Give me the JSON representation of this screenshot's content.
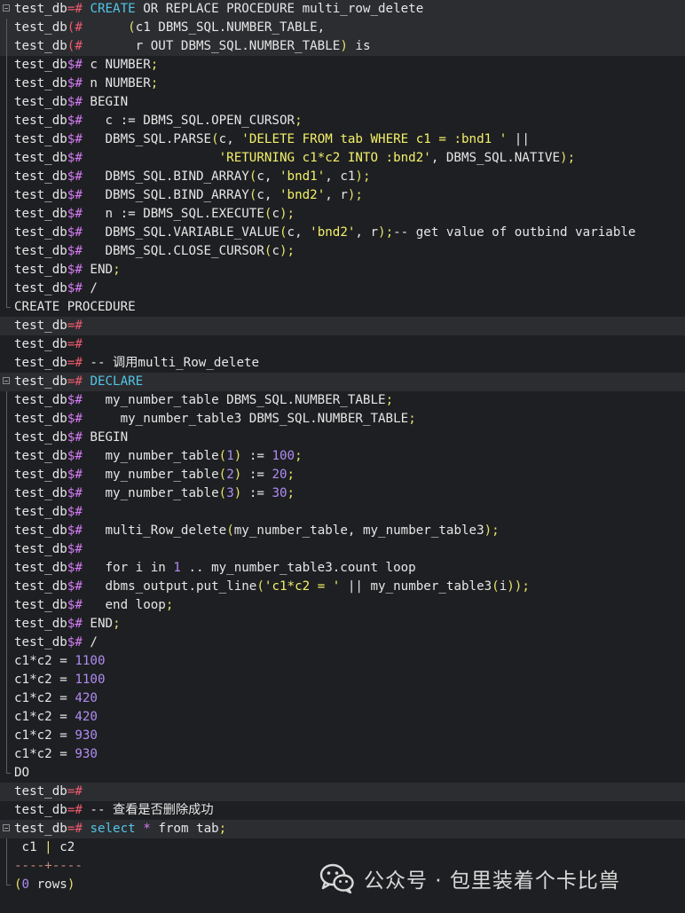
{
  "terminal": {
    "lines": [
      {
        "fold": "start",
        "hl": true,
        "segs": [
          {
            "t": "test_db",
            "c": "pr"
          },
          {
            "t": "=#",
            "c": "pc"
          },
          {
            "t": " "
          },
          {
            "t": "CREATE",
            "c": "kw"
          },
          {
            "t": " OR REPLACE PROCEDURE multi_row_delete"
          }
        ]
      },
      {
        "fold": "mid",
        "hl": true,
        "segs": [
          {
            "t": "test_db",
            "c": "pr"
          },
          {
            "t": "(#",
            "c": "pc"
          },
          {
            "t": "      "
          },
          {
            "t": "(",
            "c": "pun"
          },
          {
            "t": "c1 DBMS_SQL.NUMBER_TABLE,"
          }
        ]
      },
      {
        "fold": "mid",
        "hl": true,
        "segs": [
          {
            "t": "test_db",
            "c": "pr"
          },
          {
            "t": "(#",
            "c": "pc"
          },
          {
            "t": "       r OUT DBMS_SQL.NUMBER_TABLE"
          },
          {
            "t": ")",
            "c": "pun"
          },
          {
            "t": " is"
          }
        ]
      },
      {
        "fold": "mid",
        "hl": false,
        "segs": [
          {
            "t": "test_db",
            "c": "pr"
          },
          {
            "t": "$#",
            "c": "ps"
          },
          {
            "t": " c NUMBER"
          },
          {
            "t": ";",
            "c": "pun"
          }
        ]
      },
      {
        "fold": "mid",
        "hl": false,
        "segs": [
          {
            "t": "test_db",
            "c": "pr"
          },
          {
            "t": "$#",
            "c": "ps"
          },
          {
            "t": " n NUMBER"
          },
          {
            "t": ";",
            "c": "pun"
          }
        ]
      },
      {
        "fold": "mid",
        "hl": false,
        "segs": [
          {
            "t": "test_db",
            "c": "pr"
          },
          {
            "t": "$#",
            "c": "ps"
          },
          {
            "t": " BEGIN"
          }
        ]
      },
      {
        "fold": "mid",
        "hl": false,
        "segs": [
          {
            "t": "test_db",
            "c": "pr"
          },
          {
            "t": "$#",
            "c": "ps"
          },
          {
            "t": "   c := DBMS_SQL.OPEN_CURSOR"
          },
          {
            "t": ";",
            "c": "pun"
          }
        ]
      },
      {
        "fold": "mid",
        "hl": false,
        "segs": [
          {
            "t": "test_db",
            "c": "pr"
          },
          {
            "t": "$#",
            "c": "ps"
          },
          {
            "t": "   DBMS_SQL.PARSE"
          },
          {
            "t": "(",
            "c": "pun"
          },
          {
            "t": "c, "
          },
          {
            "t": "'DELETE FROM tab WHERE c1 = :bnd1 '",
            "c": "str"
          },
          {
            "t": " ||"
          }
        ]
      },
      {
        "fold": "mid",
        "hl": false,
        "segs": [
          {
            "t": "test_db",
            "c": "pr"
          },
          {
            "t": "$#",
            "c": "ps"
          },
          {
            "t": "                  "
          },
          {
            "t": "'RETURNING c1*c2 INTO :bnd2'",
            "c": "str"
          },
          {
            "t": ", DBMS_SQL.NATIVE"
          },
          {
            "t": ");",
            "c": "pun"
          }
        ]
      },
      {
        "fold": "mid",
        "hl": false,
        "segs": [
          {
            "t": "test_db",
            "c": "pr"
          },
          {
            "t": "$#",
            "c": "ps"
          },
          {
            "t": "   DBMS_SQL.BIND_ARRAY"
          },
          {
            "t": "(",
            "c": "pun"
          },
          {
            "t": "c, "
          },
          {
            "t": "'bnd1'",
            "c": "str"
          },
          {
            "t": ", c1"
          },
          {
            "t": ");",
            "c": "pun"
          }
        ]
      },
      {
        "fold": "mid",
        "hl": false,
        "segs": [
          {
            "t": "test_db",
            "c": "pr"
          },
          {
            "t": "$#",
            "c": "ps"
          },
          {
            "t": "   DBMS_SQL.BIND_ARRAY"
          },
          {
            "t": "(",
            "c": "pun"
          },
          {
            "t": "c, "
          },
          {
            "t": "'bnd2'",
            "c": "str"
          },
          {
            "t": ", r"
          },
          {
            "t": ");",
            "c": "pun"
          }
        ]
      },
      {
        "fold": "mid",
        "hl": false,
        "segs": [
          {
            "t": "test_db",
            "c": "pr"
          },
          {
            "t": "$#",
            "c": "ps"
          },
          {
            "t": "   n := DBMS_SQL.EXECUTE"
          },
          {
            "t": "(",
            "c": "pun"
          },
          {
            "t": "c"
          },
          {
            "t": ");",
            "c": "pun"
          }
        ]
      },
      {
        "fold": "mid",
        "hl": false,
        "segs": [
          {
            "t": "test_db",
            "c": "pr"
          },
          {
            "t": "$#",
            "c": "ps"
          },
          {
            "t": "   DBMS_SQL.VARIABLE_VALUE"
          },
          {
            "t": "(",
            "c": "pun"
          },
          {
            "t": "c, "
          },
          {
            "t": "'bnd2'",
            "c": "str"
          },
          {
            "t": ", r"
          },
          {
            "t": ");",
            "c": "pun"
          },
          {
            "t": "-- get value of outbind variable"
          }
        ]
      },
      {
        "fold": "mid",
        "hl": false,
        "segs": [
          {
            "t": "test_db",
            "c": "pr"
          },
          {
            "t": "$#",
            "c": "ps"
          },
          {
            "t": "   DBMS_SQL.CLOSE_CURSOR"
          },
          {
            "t": "(",
            "c": "pun"
          },
          {
            "t": "c"
          },
          {
            "t": ");",
            "c": "pun"
          }
        ]
      },
      {
        "fold": "mid",
        "hl": false,
        "segs": [
          {
            "t": "test_db",
            "c": "pr"
          },
          {
            "t": "$#",
            "c": "ps"
          },
          {
            "t": " END"
          },
          {
            "t": ";",
            "c": "pun"
          }
        ]
      },
      {
        "fold": "mid",
        "hl": false,
        "segs": [
          {
            "t": "test_db",
            "c": "pr"
          },
          {
            "t": "$#",
            "c": "ps"
          },
          {
            "t": " /"
          }
        ]
      },
      {
        "fold": "end",
        "hl": false,
        "segs": [
          {
            "t": "CREATE PROCEDURE"
          }
        ]
      },
      {
        "fold": "",
        "hl": true,
        "segs": [
          {
            "t": "test_db",
            "c": "pr"
          },
          {
            "t": "=#",
            "c": "pc"
          }
        ]
      },
      {
        "fold": "",
        "hl": false,
        "segs": [
          {
            "t": "test_db",
            "c": "pr"
          },
          {
            "t": "=#",
            "c": "pc"
          }
        ]
      },
      {
        "fold": "",
        "hl": false,
        "segs": [
          {
            "t": "test_db",
            "c": "pr"
          },
          {
            "t": "=#",
            "c": "pc"
          },
          {
            "t": " -- 调用multi_Row_delete"
          }
        ]
      },
      {
        "fold": "start",
        "hl": true,
        "segs": [
          {
            "t": "test_db",
            "c": "pr"
          },
          {
            "t": "=#",
            "c": "pc"
          },
          {
            "t": " "
          },
          {
            "t": "DECLARE",
            "c": "kw"
          }
        ]
      },
      {
        "fold": "mid",
        "hl": false,
        "segs": [
          {
            "t": "test_db",
            "c": "pr"
          },
          {
            "t": "$#",
            "c": "ps"
          },
          {
            "t": "   my_number_table DBMS_SQL.NUMBER_TABLE"
          },
          {
            "t": ";",
            "c": "pun"
          }
        ]
      },
      {
        "fold": "mid",
        "hl": false,
        "segs": [
          {
            "t": "test_db",
            "c": "pr"
          },
          {
            "t": "$#",
            "c": "ps"
          },
          {
            "t": "     my_number_table3 DBMS_SQL.NUMBER_TABLE"
          },
          {
            "t": ";",
            "c": "pun"
          }
        ]
      },
      {
        "fold": "mid",
        "hl": false,
        "segs": [
          {
            "t": "test_db",
            "c": "pr"
          },
          {
            "t": "$#",
            "c": "ps"
          },
          {
            "t": " BEGIN"
          }
        ]
      },
      {
        "fold": "mid",
        "hl": false,
        "segs": [
          {
            "t": "test_db",
            "c": "pr"
          },
          {
            "t": "$#",
            "c": "ps"
          },
          {
            "t": "   my_number_table"
          },
          {
            "t": "(",
            "c": "pun"
          },
          {
            "t": "1",
            "c": "num"
          },
          {
            "t": ")",
            "c": "pun"
          },
          {
            "t": " := "
          },
          {
            "t": "100",
            "c": "num"
          },
          {
            "t": ";",
            "c": "pun"
          }
        ]
      },
      {
        "fold": "mid",
        "hl": false,
        "segs": [
          {
            "t": "test_db",
            "c": "pr"
          },
          {
            "t": "$#",
            "c": "ps"
          },
          {
            "t": "   my_number_table"
          },
          {
            "t": "(",
            "c": "pun"
          },
          {
            "t": "2",
            "c": "num"
          },
          {
            "t": ")",
            "c": "pun"
          },
          {
            "t": " := "
          },
          {
            "t": "20",
            "c": "num"
          },
          {
            "t": ";",
            "c": "pun"
          }
        ]
      },
      {
        "fold": "mid",
        "hl": false,
        "segs": [
          {
            "t": "test_db",
            "c": "pr"
          },
          {
            "t": "$#",
            "c": "ps"
          },
          {
            "t": "   my_number_table"
          },
          {
            "t": "(",
            "c": "pun"
          },
          {
            "t": "3",
            "c": "num"
          },
          {
            "t": ")",
            "c": "pun"
          },
          {
            "t": " := "
          },
          {
            "t": "30",
            "c": "num"
          },
          {
            "t": ";",
            "c": "pun"
          }
        ]
      },
      {
        "fold": "mid",
        "hl": false,
        "segs": [
          {
            "t": "test_db",
            "c": "pr"
          },
          {
            "t": "$#",
            "c": "ps"
          }
        ]
      },
      {
        "fold": "mid",
        "hl": false,
        "segs": [
          {
            "t": "test_db",
            "c": "pr"
          },
          {
            "t": "$#",
            "c": "ps"
          },
          {
            "t": "   multi_Row_delete"
          },
          {
            "t": "(",
            "c": "pun"
          },
          {
            "t": "my_number_table, my_number_table3"
          },
          {
            "t": ");",
            "c": "pun"
          }
        ]
      },
      {
        "fold": "mid",
        "hl": false,
        "segs": [
          {
            "t": "test_db",
            "c": "pr"
          },
          {
            "t": "$#",
            "c": "ps"
          }
        ]
      },
      {
        "fold": "mid",
        "hl": false,
        "segs": [
          {
            "t": "test_db",
            "c": "pr"
          },
          {
            "t": "$#",
            "c": "ps"
          },
          {
            "t": "   for i in "
          },
          {
            "t": "1",
            "c": "num"
          },
          {
            "t": " .. my_number_table3.count loop"
          }
        ]
      },
      {
        "fold": "mid",
        "hl": false,
        "segs": [
          {
            "t": "test_db",
            "c": "pr"
          },
          {
            "t": "$#",
            "c": "ps"
          },
          {
            "t": "   dbms_output.put_line"
          },
          {
            "t": "(",
            "c": "pun"
          },
          {
            "t": "'c1*c2 = '",
            "c": "str"
          },
          {
            "t": " || my_number_table3"
          },
          {
            "t": "(",
            "c": "pun"
          },
          {
            "t": "i"
          },
          {
            "t": "));",
            "c": "pun"
          }
        ]
      },
      {
        "fold": "mid",
        "hl": false,
        "segs": [
          {
            "t": "test_db",
            "c": "pr"
          },
          {
            "t": "$#",
            "c": "ps"
          },
          {
            "t": "   end loop"
          },
          {
            "t": ";",
            "c": "pun"
          }
        ]
      },
      {
        "fold": "mid",
        "hl": false,
        "segs": [
          {
            "t": "test_db",
            "c": "pr"
          },
          {
            "t": "$#",
            "c": "ps"
          },
          {
            "t": " END"
          },
          {
            "t": ";",
            "c": "pun"
          }
        ]
      },
      {
        "fold": "mid",
        "hl": false,
        "segs": [
          {
            "t": "test_db",
            "c": "pr"
          },
          {
            "t": "$#",
            "c": "ps"
          },
          {
            "t": " /"
          }
        ]
      },
      {
        "fold": "mid",
        "hl": false,
        "segs": [
          {
            "t": "c1*c2 = "
          },
          {
            "t": "1100",
            "c": "num"
          }
        ]
      },
      {
        "fold": "mid",
        "hl": false,
        "segs": [
          {
            "t": "c1*c2 = "
          },
          {
            "t": "1100",
            "c": "num"
          }
        ]
      },
      {
        "fold": "mid",
        "hl": false,
        "segs": [
          {
            "t": "c1*c2 = "
          },
          {
            "t": "420",
            "c": "num"
          }
        ]
      },
      {
        "fold": "mid",
        "hl": false,
        "segs": [
          {
            "t": "c1*c2 = "
          },
          {
            "t": "420",
            "c": "num"
          }
        ]
      },
      {
        "fold": "mid",
        "hl": false,
        "segs": [
          {
            "t": "c1*c2 = "
          },
          {
            "t": "930",
            "c": "num"
          }
        ]
      },
      {
        "fold": "mid",
        "hl": false,
        "segs": [
          {
            "t": "c1*c2 = "
          },
          {
            "t": "930",
            "c": "num"
          }
        ]
      },
      {
        "fold": "end",
        "hl": false,
        "segs": [
          {
            "t": "DO"
          }
        ]
      },
      {
        "fold": "",
        "hl": true,
        "segs": [
          {
            "t": "test_db",
            "c": "pr"
          },
          {
            "t": "=#",
            "c": "pc"
          }
        ]
      },
      {
        "fold": "",
        "hl": false,
        "segs": [
          {
            "t": "test_db",
            "c": "pr"
          },
          {
            "t": "=#",
            "c": "pc"
          },
          {
            "t": " -- 查看是否删除成功"
          }
        ]
      },
      {
        "fold": "start",
        "hl": true,
        "segs": [
          {
            "t": "test_db",
            "c": "pr"
          },
          {
            "t": "=#",
            "c": "pc"
          },
          {
            "t": " "
          },
          {
            "t": "select",
            "c": "kw"
          },
          {
            "t": " "
          },
          {
            "t": "*",
            "c": "op"
          },
          {
            "t": " from tab"
          },
          {
            "t": ";",
            "c": "pun"
          }
        ]
      },
      {
        "fold": "mid",
        "hl": false,
        "segs": [
          {
            "t": " c1 "
          },
          {
            "t": "|",
            "c": "pun"
          },
          {
            "t": " c2"
          }
        ]
      },
      {
        "fold": "mid",
        "hl": false,
        "segs": [
          {
            "t": "----+----",
            "c": "dim"
          }
        ]
      },
      {
        "fold": "end",
        "hl": false,
        "segs": [
          {
            "t": "(",
            "c": "pun"
          },
          {
            "t": "0",
            "c": "num"
          },
          {
            "t": " rows"
          },
          {
            "t": ")",
            "c": "pun"
          }
        ]
      }
    ]
  },
  "watermark": {
    "icon": "wechat-icon",
    "text": "公众号 · 包里装着个卡比兽"
  }
}
